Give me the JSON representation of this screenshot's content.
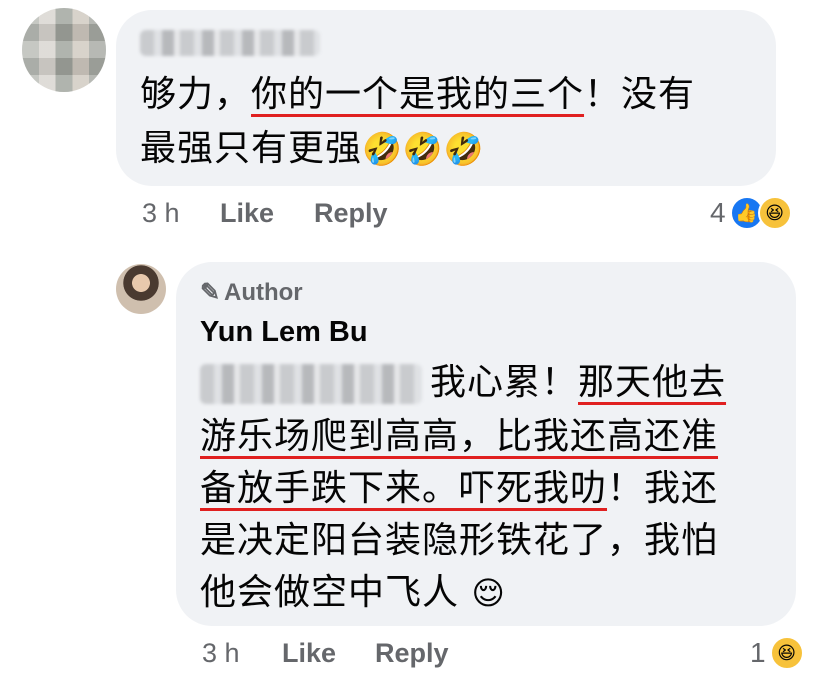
{
  "comment1": {
    "line1_plain": "够力，",
    "line1_underlined": "你的一个是我的三个",
    "line1_end": "！没有",
    "line2": "最强只有更强",
    "emojis": [
      "🤣",
      "🤣",
      "🤣"
    ],
    "time": "3 h",
    "like_label": "Like",
    "reply_label": "Reply",
    "reaction_count": "4",
    "reaction_icons": [
      "like-icon",
      "haha-icon"
    ]
  },
  "comment2": {
    "author_badge": "Author",
    "author_name": "Yun Lem Bu",
    "l1_plain": "我心累！",
    "l1_underlined": "那天他去",
    "l2_underlined": "游乐场爬到高高，比我还高还准",
    "l3_underlined": "备放手跌下来。吓死我叻",
    "l3_end": "！我还",
    "l4": "是决定阳台装隐形铁花了，我怕",
    "l5": "他会做空中飞人 ",
    "emoji": "😌",
    "time": "3 h",
    "like_label": "Like",
    "reply_label": "Reply",
    "reaction_count": "1",
    "reaction_icons": [
      "haha-icon"
    ]
  },
  "colors": {
    "bubble": "#f0f2f5",
    "meta": "#65676b",
    "underline": "#e02020",
    "like_blue": "#1877f2"
  }
}
